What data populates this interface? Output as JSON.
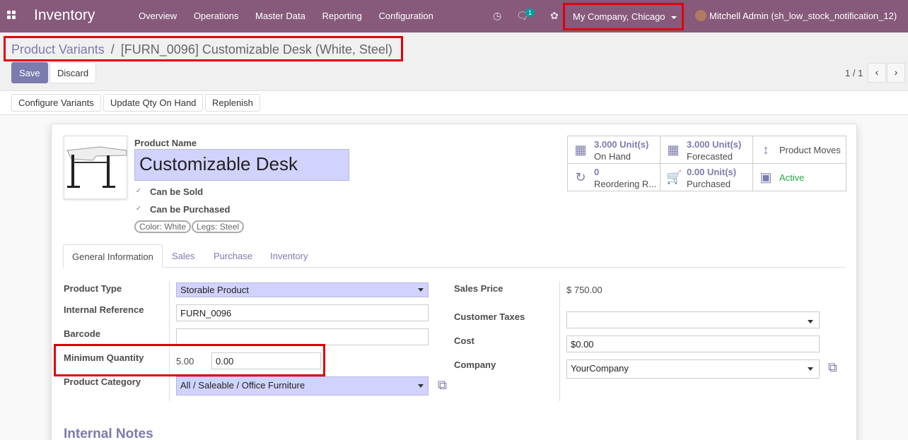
{
  "navbar": {
    "brand": "Inventory",
    "menu": [
      "Overview",
      "Operations",
      "Master Data",
      "Reporting",
      "Configuration"
    ],
    "message_count": "1",
    "company": "My Company, Chicago",
    "user": "Mitchell Admin (sh_low_stock_notification_12)"
  },
  "breadcrumb": {
    "parent": "Product Variants",
    "separator": "/",
    "current": "[FURN_0096] Customizable Desk (White, Steel)"
  },
  "toolbar": {
    "save_label": "Save",
    "discard_label": "Discard"
  },
  "pager": {
    "text": "1 / 1",
    "prev": "‹",
    "next": "›"
  },
  "actions": {
    "configure": "Configure Variants",
    "update_qty": "Update Qty On Hand",
    "replenish": "Replenish"
  },
  "product": {
    "name_label": "Product Name",
    "name": "Customizable Desk",
    "can_be_sold": "Can be Sold",
    "can_be_purchased": "Can be Purchased",
    "tags": [
      "Color: White",
      "Legs: Steel"
    ]
  },
  "stats": {
    "on_hand_value": "3.000",
    "on_hand_unit": "Unit(s)",
    "on_hand_label": "On Hand",
    "forecast_value": "3.000",
    "forecast_unit": "Unit(s)",
    "forecast_label": "Forecasted",
    "moves_label": "Product Moves",
    "reorder_value": "0",
    "reorder_label": "Reordering R...",
    "purchased_value": "0.00",
    "purchased_unit": "Unit(s)",
    "purchased_label": "Purchased",
    "active_label": "Active",
    "active_color": "#28a745"
  },
  "tabs": [
    "General Information",
    "Sales",
    "Purchase",
    "Inventory"
  ],
  "general": {
    "product_type_label": "Product Type",
    "product_type": "Storable Product",
    "internal_ref_label": "Internal Reference",
    "internal_ref": "FURN_0096",
    "barcode_label": "Barcode",
    "barcode": "",
    "min_qty_label": "Minimum Quantity",
    "min_qty_readonly": "5.00",
    "min_qty_value": "0.00",
    "category_label": "Product Category",
    "category": "All / Saleable / Office Furniture",
    "sales_price_label": "Sales Price",
    "sales_price": "$ 750.00",
    "taxes_label": "Customer Taxes",
    "cost_label": "Cost",
    "cost": "$0.00",
    "company_label": "Company",
    "company": "YourCompany"
  },
  "notes_heading": "Internal Notes",
  "colors": {
    "brand": "#875a7b",
    "accent": "#7c7bad",
    "highlight": "#e0000b"
  }
}
